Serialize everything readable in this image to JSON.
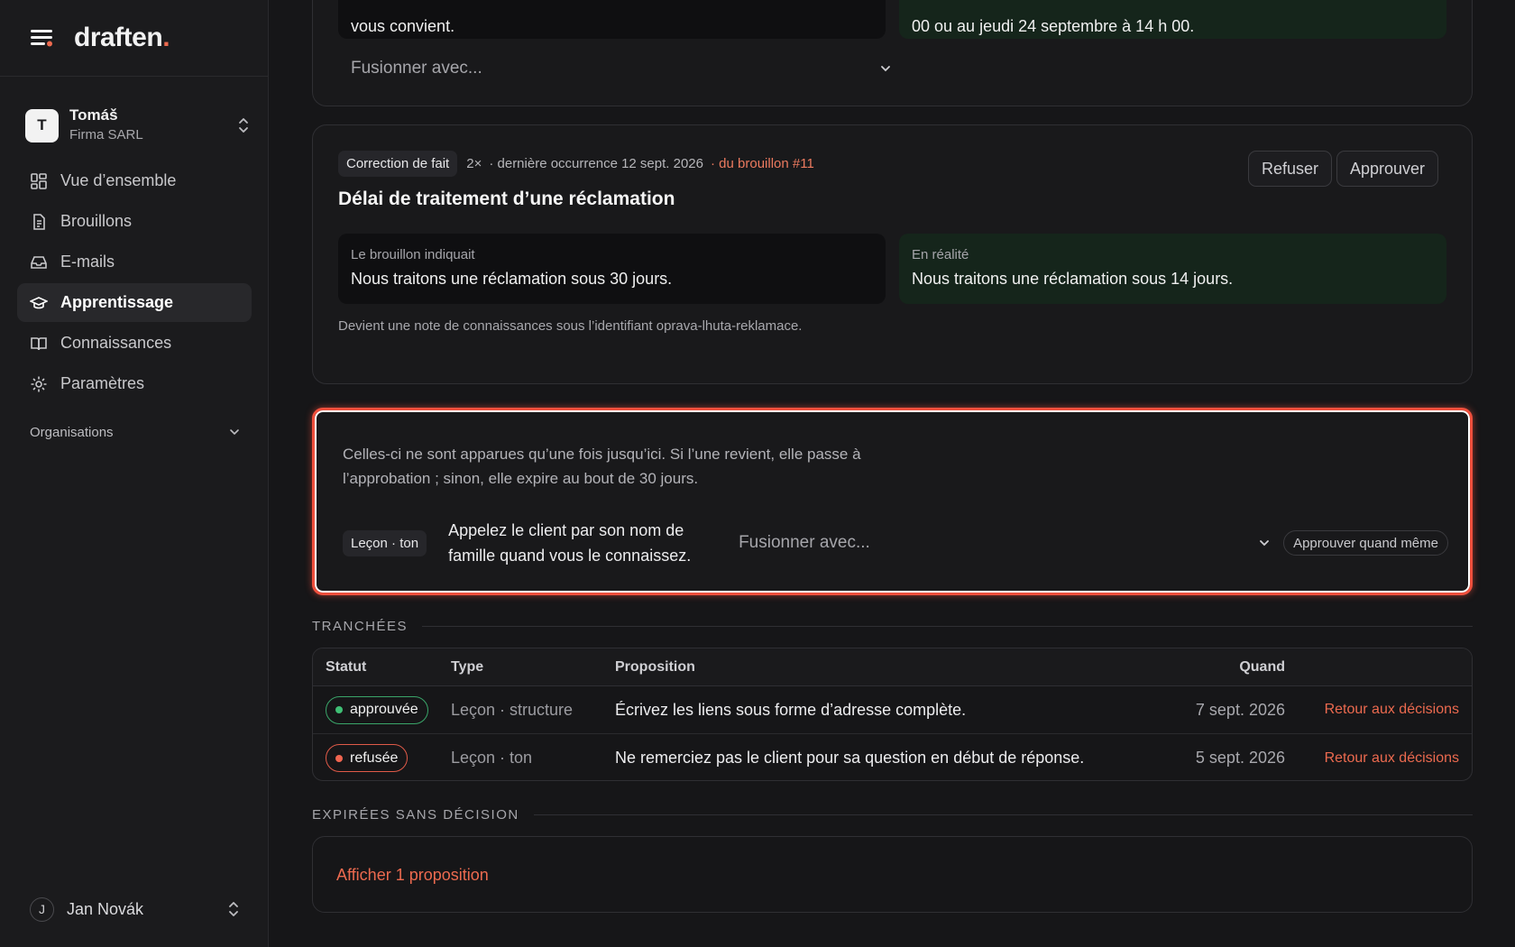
{
  "app": {
    "logo_text": "draften",
    "logo_dot": ".",
    "accent": "#ec6a4f"
  },
  "org": {
    "initial": "T",
    "name": "Tomáš",
    "company": "Firma SARL"
  },
  "nav": [
    {
      "label": "Vue d’ensemble",
      "icon": "dashboard-icon"
    },
    {
      "label": "Brouillons",
      "icon": "document-icon"
    },
    {
      "label": "E-mails",
      "icon": "inbox-icon"
    },
    {
      "label": "Apprentissage",
      "icon": "graduation-cap-icon",
      "active": true
    },
    {
      "label": "Connaissances",
      "icon": "book-icon"
    },
    {
      "label": "Paramètres",
      "icon": "gear-icon"
    }
  ],
  "organisations_label": "Organisations",
  "user": {
    "initial": "J",
    "name": "Jan Novák"
  },
  "top_card": {
    "left_text": "vous convient.",
    "right_text": "00 ou au jeudi 24 septembre à 14 h 00.",
    "merge_placeholder": "Fusionner avec..."
  },
  "fact_card": {
    "tag": "Correction de fait",
    "count": "2×",
    "last_occurrence": "· dernière occurrence 12 sept. 2026",
    "draft_ref": "· du brouillon #11",
    "title": "Délai de traitement d’une réclamation",
    "reject_label": "Refuser",
    "approve_label": "Approuver",
    "draft_label": "Le brouillon indiquait",
    "draft_text": "Nous traitons une réclamation sous 30 jours.",
    "reality_label": "En réalité",
    "reality_text": "Nous traitons une réclamation sous 14 jours.",
    "note": "Devient une note de connaissances sous l’identifiant oprava-lhuta-reklamace."
  },
  "single_card": {
    "description": "Celles-ci ne sont apparues qu’une fois jusqu’ici. Si l’une revient, elle passe à l’approbation ; sinon, elle expire au bout de 30 jours.",
    "tag": "Leçon · ton",
    "lesson": "Appelez le client par son nom de famille quand vous le connaissez.",
    "merge_placeholder": "Fusionner avec...",
    "approve_anyway": "Approuver quand même"
  },
  "decided": {
    "title": "TRANCHÉES",
    "columns": {
      "status": "Statut",
      "type": "Type",
      "proposal": "Proposition",
      "when": "Quand"
    },
    "rows": [
      {
        "status": "approuvée",
        "status_kind": "approved",
        "type": "Leçon · structure",
        "proposal": "Écrivez les liens sous forme d’adresse complète.",
        "when": "7 sept. 2026",
        "action": "Retour aux décisions"
      },
      {
        "status": "refusée",
        "status_kind": "rejected",
        "type": "Leçon · ton",
        "proposal": "Ne remerciez pas le client pour sa question en début de réponse.",
        "when": "5 sept. 2026",
        "action": "Retour aux décisions"
      }
    ]
  },
  "expired": {
    "title": "EXPIRÉES SANS DÉCISION",
    "link": "Afficher 1 proposition"
  }
}
